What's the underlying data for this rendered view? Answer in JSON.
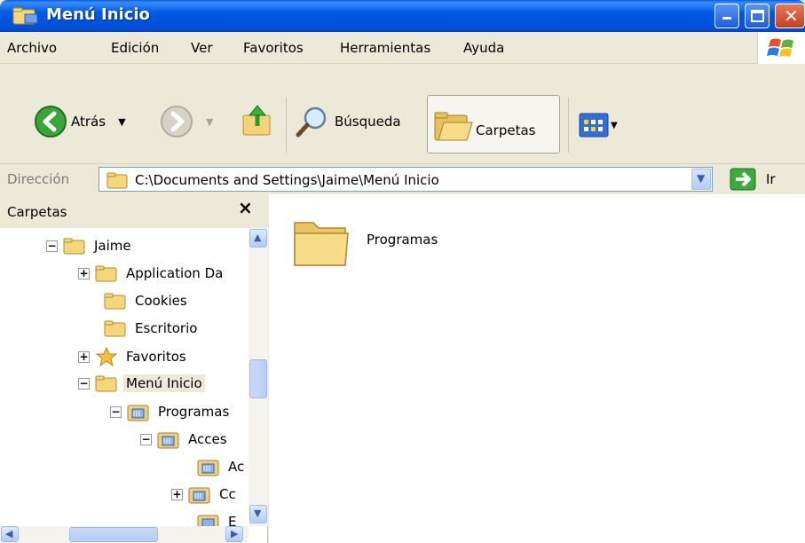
{
  "window": {
    "title": "Menú Inicio"
  },
  "menu": [
    "Archivo",
    "Edición",
    "Ver",
    "Favoritos",
    "Herramientas",
    "Ayuda"
  ],
  "toolbar": {
    "back_label": "Atrás",
    "search_label": "Búsqueda",
    "folders_label": "Carpetas"
  },
  "address": {
    "label": "Dirección",
    "value": "C:\\Documents and Settings\\Jaime\\Menú Inicio",
    "go_label": "Ir"
  },
  "left_panel": {
    "title": "Carpetas",
    "close_label": "×",
    "tree": [
      {
        "label": "Jaime",
        "expander": "−"
      },
      {
        "label": "Application Da",
        "expander": "+"
      },
      {
        "label": "Cookies",
        "expander": ""
      },
      {
        "label": "Escritorio",
        "expander": ""
      },
      {
        "label": "Favoritos",
        "expander": "+"
      },
      {
        "label": "Menú Inicio",
        "expander": "−"
      },
      {
        "label": "Programas",
        "expander": "−"
      },
      {
        "label": "Acces",
        "expander": "−"
      },
      {
        "label": "Ac",
        "expander": ""
      },
      {
        "label": "Cc",
        "expander": "+"
      },
      {
        "label": "E",
        "expander": ""
      }
    ]
  },
  "content": {
    "items": [
      {
        "label": "Programas"
      }
    ]
  },
  "colors": {
    "titlebar": "#0058e6",
    "chrome": "#ece9d8",
    "folder": "#f5d87e"
  }
}
